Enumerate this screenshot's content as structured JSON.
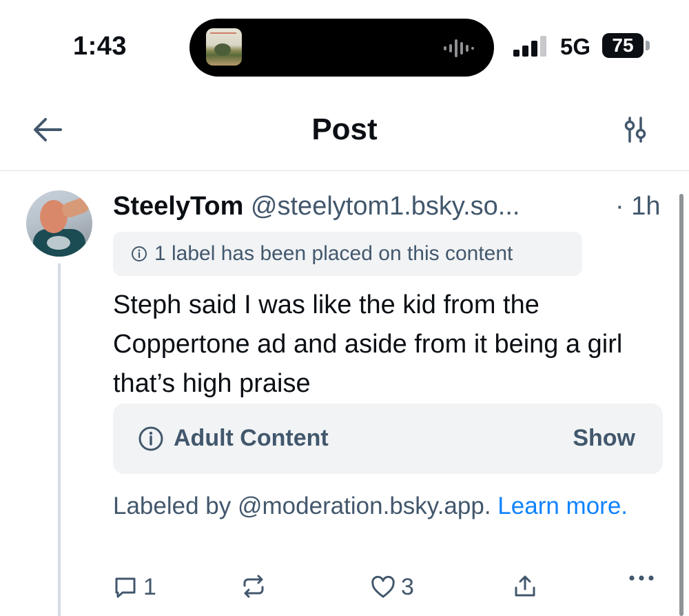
{
  "status_bar": {
    "time": "1:43",
    "network": "5G",
    "battery": "75"
  },
  "header": {
    "title": "Post",
    "back_icon": "arrow-left-icon",
    "filter_icon": "sliders-icon"
  },
  "post": {
    "author_name": "SteelyTom",
    "author_handle": "@steelytom1.bsky.so...",
    "timestamp": "· 1h",
    "label_notice": "1 label has been placed on this content",
    "text": "Steph said I was like the kid from the Coppertone ad and aside from it being a girl that’s high praise",
    "content_warning": {
      "label": "Adult Content",
      "action": "Show"
    },
    "labeled_by": "Labeled by @moderation.bsky.app.",
    "learn_more": "Learn more.",
    "actions": {
      "reply_count": "1",
      "repost_count": "",
      "like_count": "3"
    }
  },
  "colors": {
    "accent_link": "#1083fe",
    "muted_text": "#42576c",
    "chip_background": "#f1f3f5"
  }
}
